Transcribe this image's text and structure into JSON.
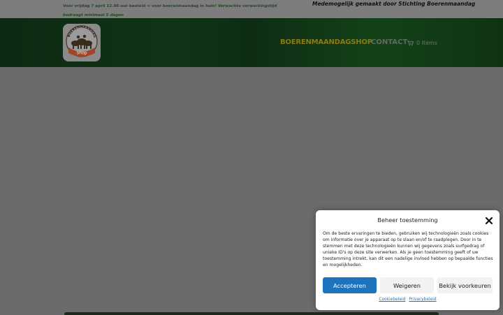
{
  "topbar": {
    "notice_bold": "Voor vrijdag 7 april 12.00 uur besteld = voor boerenmaandag in huis!",
    "notice_italic": "Verwachte verwerkingstijd bedraagt minimaal 5 dagen",
    "sponsor": "Medemogelijk gemaakt door Stichting Boerenmaandag"
  },
  "header": {
    "logo_text": "Shop",
    "logo_arc_text": "BOERENMAANDAG",
    "nav": {
      "shop": "BOERENMAANDAGSHOP",
      "contact": "CONTACT"
    },
    "cart": {
      "icon": "cart-icon",
      "label": "0 Items"
    }
  },
  "consent": {
    "title": "Beheer toestemming",
    "close_icon": "close-icon",
    "body": "Om de beste ervaringen te bieden, gebruiken wij technologieën zoals cookies om informatie over je apparaat op te slaan en/of te raadplegen. Door in te stemmen met deze technologieën kunnen wij gegevens zoals surfgedrag of unieke ID's op deze site verwerken. Als je geen toestemming geeft of uw toestemming intrekt, kan dit een nadelige invloed hebben op bepaalde functies en mogelijkheden.",
    "buttons": {
      "accept": "Accepteren",
      "deny": "Weigeren",
      "preferences": "Bekijk voorkeuren"
    },
    "links": {
      "cookie_policy": "Cookiebeleid",
      "privacy_policy": "Privacybeleid"
    },
    "colors": {
      "primary": "#1e73be"
    }
  }
}
